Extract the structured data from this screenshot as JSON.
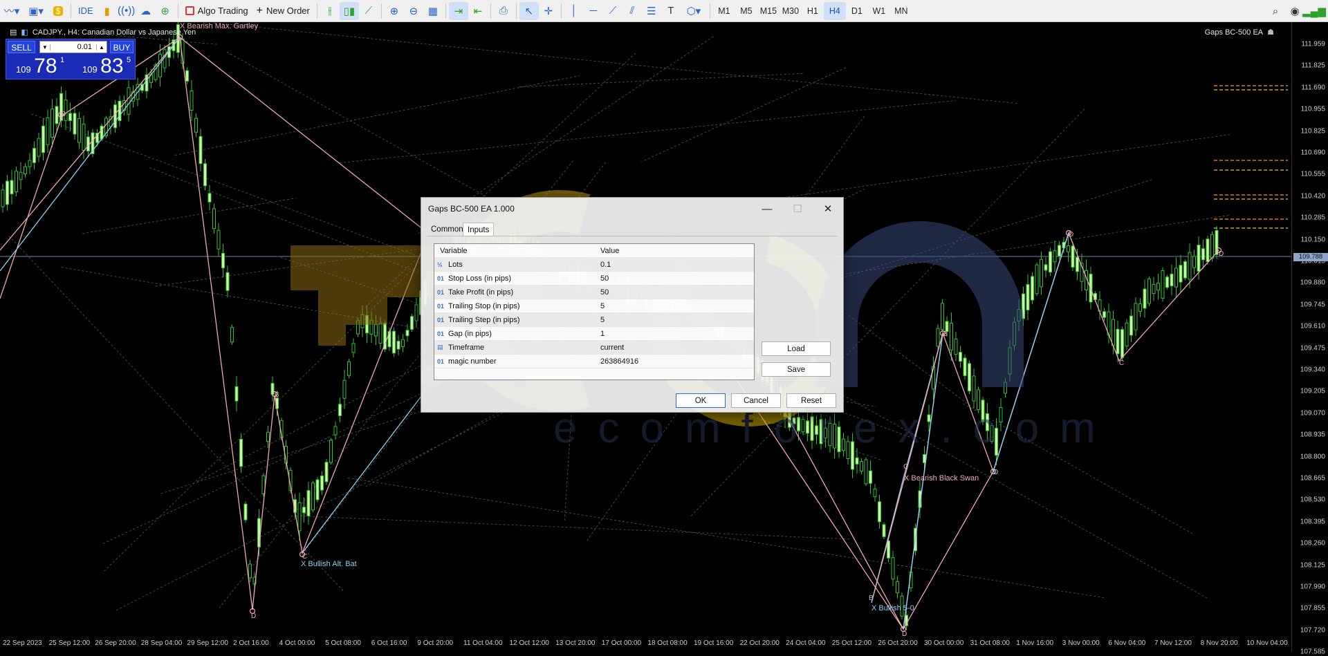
{
  "toolbar": {
    "algo_trading_label": "Algo Trading",
    "new_order_label": "New Order",
    "ide_label": "IDE",
    "timeframes": [
      "M1",
      "M5",
      "M15",
      "M30",
      "H1",
      "H4",
      "D1",
      "W1",
      "MN"
    ],
    "active_timeframe": "H4"
  },
  "chart": {
    "title": "CADJPY., H4:  Canadian Dollar vs Japanese Yen",
    "ea_label": "Gaps BC-500 EA",
    "current_price": "109.788",
    "price_ticks": [
      "111.959",
      "111.825",
      "111.690",
      "110.955",
      "110.825",
      "110.690",
      "110.555",
      "110.420",
      "110.285",
      "110.150",
      "110.015",
      "109.880",
      "109.745",
      "109.610",
      "109.475",
      "109.340",
      "109.205",
      "109.070",
      "108.935",
      "108.800",
      "108.665",
      "108.530",
      "108.395",
      "108.260",
      "108.125",
      "107.990",
      "107.855",
      "107.720",
      "107.585"
    ],
    "time_ticks": [
      "22 Sep 2023",
      "25 Sep 12:00",
      "26 Sep 20:00",
      "28 Sep 04:00",
      "29 Sep 12:00",
      "2 Oct 16:00",
      "4 Oct 00:00",
      "5 Oct 08:00",
      "6 Oct 16:00",
      "9 Oct 20:00",
      "11 Oct 04:00",
      "12 Oct 12:00",
      "13 Oct 20:00",
      "17 Oct 00:00",
      "18 Oct 08:00",
      "19 Oct 16:00",
      "22 Oct 20:00",
      "24 Oct 04:00",
      "25 Oct 12:00",
      "26 Oct 20:00",
      "30 Oct 00:00",
      "31 Oct 08:00",
      "1 Nov 16:00",
      "3 Nov 00:00",
      "6 Nov 04:00",
      "7 Nov 12:00",
      "8 Nov 20:00",
      "10 Nov 04:00"
    ],
    "patterns": [
      {
        "label": "X Bearish Max. Gartley",
        "color": "#f4a8b4"
      },
      {
        "label": "X Bullish Alt. Bat",
        "color": "#8fd0f5"
      },
      {
        "label": "X Bearish Black Swan",
        "color": "#f4a8b4"
      },
      {
        "label": "X Bullish 5-0",
        "color": "#8fd0f5"
      }
    ],
    "point_labels": [
      "D",
      "D",
      "B",
      "C",
      "D",
      "B",
      "C",
      "D",
      "D",
      "B",
      "C",
      "D"
    ]
  },
  "trade_panel": {
    "sell_label": "SELL",
    "buy_label": "BUY",
    "lot_value": "0.01",
    "sell_price_small": "109",
    "sell_price_big": "78",
    "sell_price_sup": "1",
    "buy_price_small": "109",
    "buy_price_big": "83",
    "buy_price_sup": "5"
  },
  "watermark": {
    "text": "ecomforex.com"
  },
  "dialog": {
    "title": "Gaps BC-500 EA 1.000",
    "tabs": [
      "Common",
      "Inputs"
    ],
    "active_tab": "Inputs",
    "col_variable": "Variable",
    "col_value": "Value",
    "params": [
      {
        "icon": "½",
        "name": "Lots",
        "value": "0.1"
      },
      {
        "icon": "01",
        "name": "Stop Loss (in pips)",
        "value": "50"
      },
      {
        "icon": "01",
        "name": "Take Profit (in pips)",
        "value": "50"
      },
      {
        "icon": "01",
        "name": "Trailing Stop (in pips)",
        "value": "5"
      },
      {
        "icon": "01",
        "name": "Trailing Step (in pips)",
        "value": "5"
      },
      {
        "icon": "01",
        "name": "Gap (in pips)",
        "value": "1"
      },
      {
        "icon": "▤",
        "name": "Timeframe",
        "value": "current"
      },
      {
        "icon": "01",
        "name": "magic number",
        "value": "263864916"
      }
    ],
    "load_label": "Load",
    "save_label": "Save",
    "ok_label": "OK",
    "cancel_label": "Cancel",
    "reset_label": "Reset"
  }
}
